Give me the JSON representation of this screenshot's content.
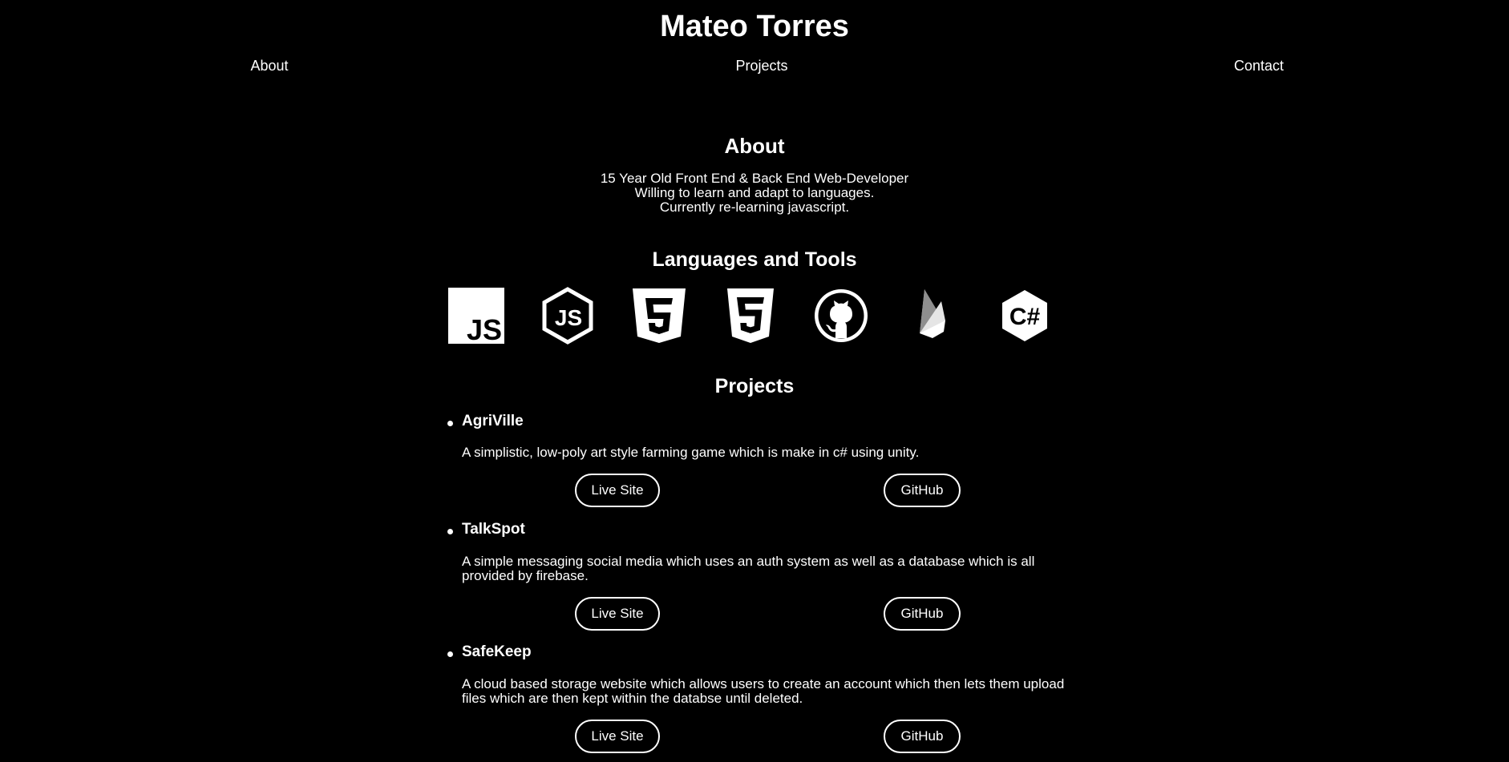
{
  "header": {
    "title": "Mateo Torres",
    "nav": [
      {
        "label": "About"
      },
      {
        "label": "Projects"
      },
      {
        "label": "Contact"
      }
    ]
  },
  "about": {
    "heading": "About",
    "lines": [
      "15 Year Old Front End & Back End Web-Developer",
      "Willing to learn and adapt to languages.",
      "Currently re-learning javascript."
    ]
  },
  "tools": {
    "heading": "Languages and Tools",
    "icons": [
      "javascript-icon",
      "nodejs-icon",
      "html5-icon",
      "css3-icon",
      "github-icon",
      "firebase-icon",
      "csharp-icon"
    ]
  },
  "projects": {
    "heading": "Projects",
    "items": [
      {
        "title": "AgriVille",
        "description": "A simplistic, low-poly art style farming game which is make in c# using unity.",
        "live_label": "Live Site",
        "github_label": "GitHub"
      },
      {
        "title": "TalkSpot",
        "description": "A simple messaging social media which uses an auth system as well as a database which is all provided by firebase.",
        "live_label": "Live Site",
        "github_label": "GitHub"
      },
      {
        "title": "SafeKeep",
        "description": "A cloud based storage website which allows users to create an account which then lets them upload files which are then kept within the databse until deleted.",
        "live_label": "Live Site",
        "github_label": "GitHub"
      }
    ]
  },
  "colors": {
    "background": "#000000",
    "foreground": "#ffffff"
  }
}
